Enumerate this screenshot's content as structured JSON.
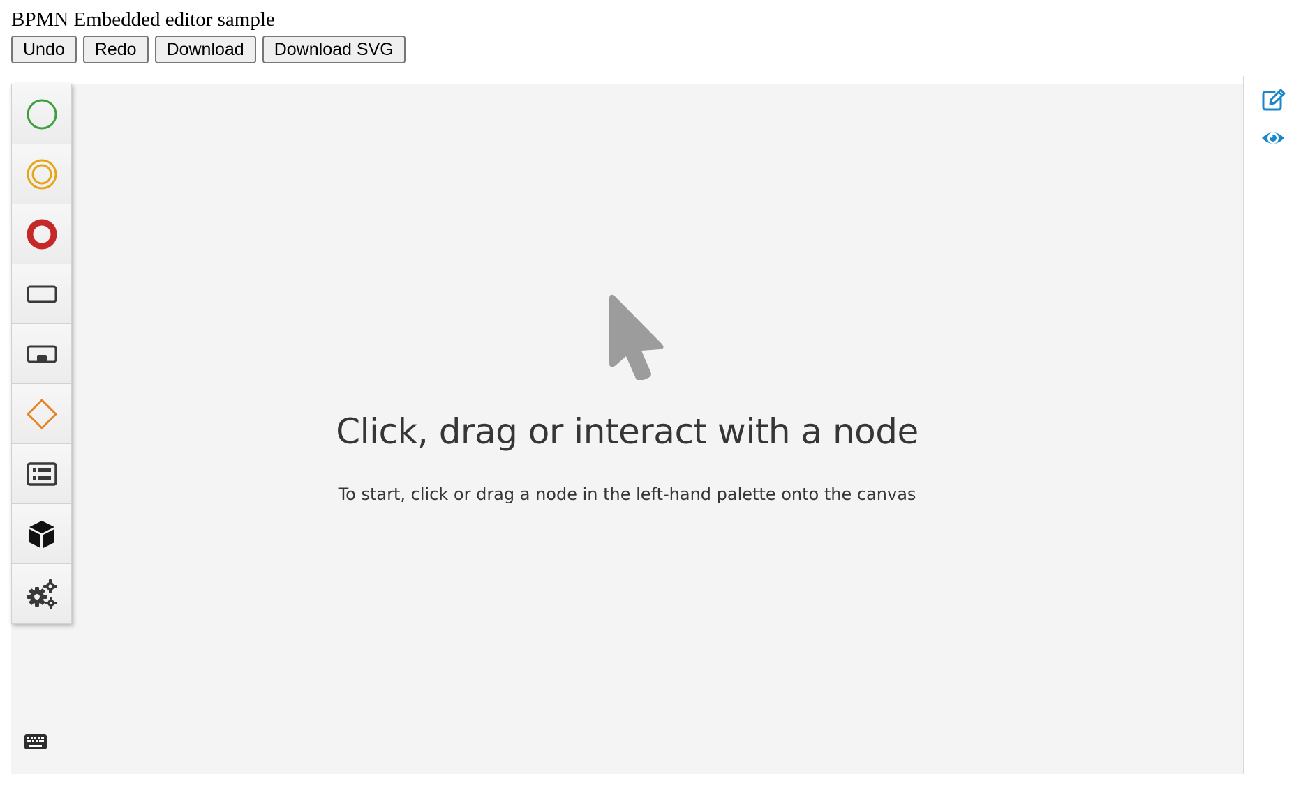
{
  "page": {
    "title": "BPMN Embedded editor sample"
  },
  "toolbar": {
    "undo_label": "Undo",
    "redo_label": "Redo",
    "download_label": "Download",
    "download_svg_label": "Download SVG"
  },
  "palette": {
    "items": [
      {
        "icon": "start-event-icon",
        "color": "#3f9f3f"
      },
      {
        "icon": "intermediate-event-icon",
        "color": "#e6a417"
      },
      {
        "icon": "end-event-icon",
        "color": "#c62828"
      },
      {
        "icon": "task-icon",
        "color": "#393939"
      },
      {
        "icon": "subprocess-icon",
        "color": "#393939"
      },
      {
        "icon": "gateway-icon",
        "color": "#e8831f"
      },
      {
        "icon": "data-object-icon",
        "color": "#393939"
      },
      {
        "icon": "custom-node-icon",
        "color": "#111111"
      },
      {
        "icon": "service-task-icon",
        "color": "#393939"
      }
    ]
  },
  "empty_state": {
    "title": "Click, drag or interact with a node",
    "subtitle": "To start, click or drag a node in the left-hand palette onto the canvas"
  },
  "right_panel": {
    "icons": [
      "edit-icon",
      "preview-icon"
    ],
    "accent_color": "#1a87c8"
  },
  "colors": {
    "canvas_background": "#f4f4f4",
    "pointer_gray": "#9c9c9c",
    "text_dark": "#363636"
  }
}
